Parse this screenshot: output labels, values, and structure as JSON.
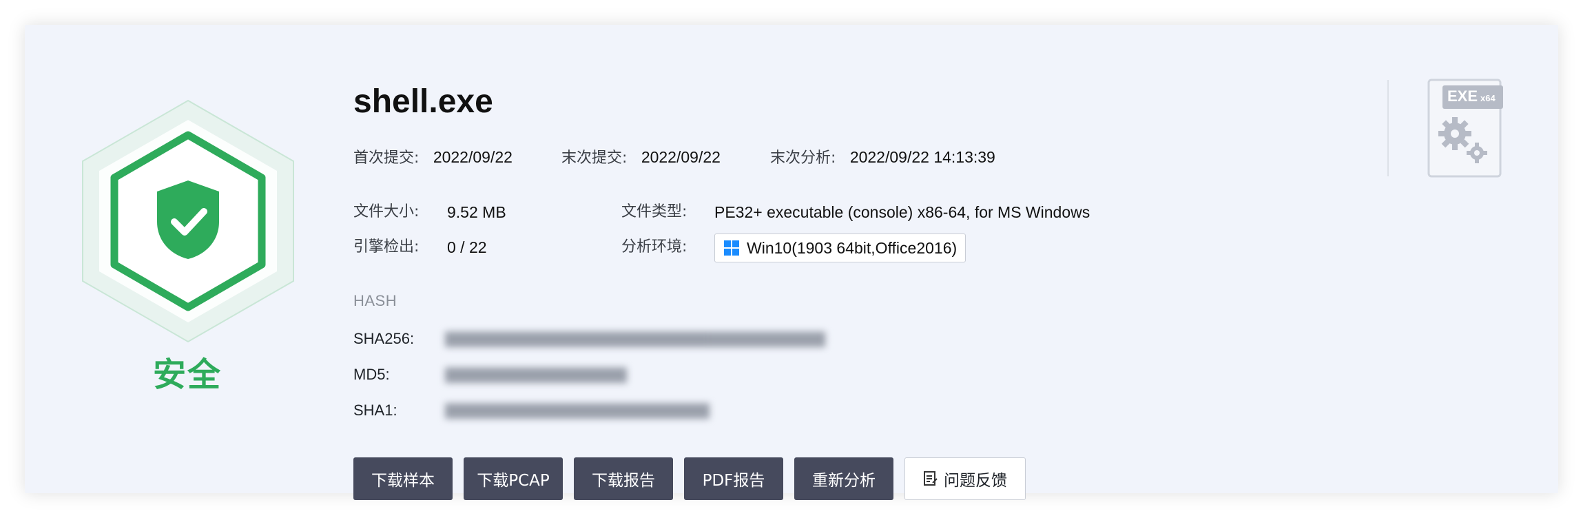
{
  "verdict": {
    "label": "安全",
    "color": "#2eab5b",
    "icon": "shield-check-icon"
  },
  "file": {
    "name": "shell.exe",
    "type_badge": "EXE",
    "arch_badge": "x64",
    "icon": "exe-gears-icon"
  },
  "submission": {
    "first_label": "首次提交:",
    "first_value": "2022/09/22",
    "last_label": "末次提交:",
    "last_value": "2022/09/22",
    "analysis_label": "末次分析:",
    "analysis_value": "2022/09/22 14:13:39"
  },
  "info": {
    "size_label": "文件大小:",
    "size_value": "9.52 MB",
    "type_label": "文件类型:",
    "type_value": "PE32+ executable (console) x86-64, for MS Windows",
    "engine_label": "引擎检出:",
    "engine_value": "0 / 22",
    "env_label": "分析环境:",
    "env_value": "Win10(1903 64bit,Office2016)",
    "env_icon": "windows-logo-icon"
  },
  "hash": {
    "heading": "HASH",
    "sha256_label": "SHA256:",
    "md5_label": "MD5:",
    "sha1_label": "SHA1:"
  },
  "actions": {
    "download_sample": "下载样本",
    "download_pcap": "下载PCAP",
    "download_report": "下载报告",
    "pdf_report": "PDF报告",
    "reanalyze": "重新分析",
    "feedback": "问题反馈",
    "feedback_icon": "edit-note-icon"
  }
}
